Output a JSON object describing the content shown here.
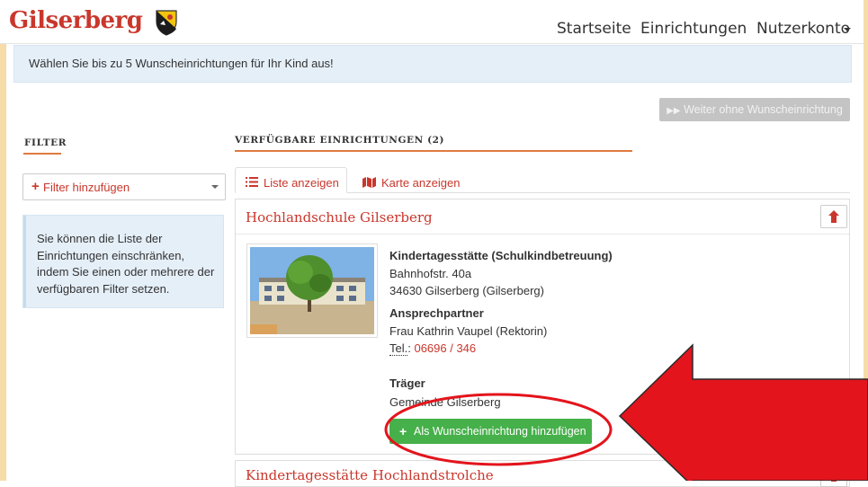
{
  "header": {
    "brand": "Gilserberg",
    "nav": [
      "Startseite",
      "Einrichtungen",
      "Nutzerkonto"
    ]
  },
  "alert_text": "Wählen Sie bis zu 5 Wunscheinrichtungen für Ihr Kind aus!",
  "continue_button": "Weiter ohne Wunscheinrichtung",
  "filter": {
    "heading": "FILTER",
    "add_label": "Filter hinzufügen",
    "info_text": "Sie können die Liste der Einrichtungen einschränken, indem Sie einen oder mehrere der verfügbaren Filter setzen."
  },
  "available": {
    "heading": "VERFÜGBARE EINRICHTUNGEN (2)",
    "tabs": [
      "Liste anzeigen",
      "Karte anzeigen"
    ]
  },
  "facility": {
    "name": "Hochlandschule Gilserberg",
    "type": "Kindertagesstätte (Schulkindbetreuung)",
    "street": "Bahnhofstr. 40a",
    "city": "34630 Gilserberg (Gilserberg)",
    "contact_heading": "Ansprechpartner",
    "contact_name": "Frau Kathrin Vaupel (Rektorin)",
    "phone_label": "Tel.",
    "phone": "06696 / 346",
    "carrier_heading": "Träger",
    "carrier": "Gemeinde Gilserberg",
    "add_button": "Als Wunscheinrichtung hinzufügen"
  },
  "next_facility": {
    "name": "Kindertagesstätte Hochlandstrolche"
  },
  "colors": {
    "brand": "#c9372c",
    "accent_underline": "#e07a3f",
    "add_button": "#46b04a",
    "annotation_red": "#e3141c"
  }
}
